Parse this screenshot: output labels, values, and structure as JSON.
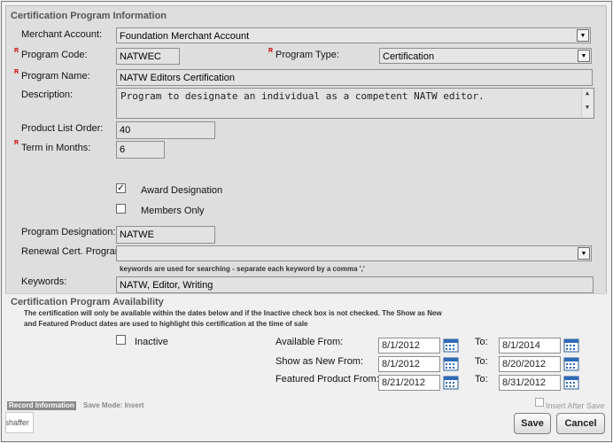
{
  "section_info": {
    "title": "Certification Program Information"
  },
  "merchant": {
    "label": "Merchant Account:",
    "value": "Foundation Merchant Account"
  },
  "program_code": {
    "label": "Program Code:",
    "value": "NATWEC"
  },
  "program_type": {
    "label": "Program Type:",
    "value": "Certification"
  },
  "program_name": {
    "label": "Program Name:",
    "value": "NATW Editors Certification"
  },
  "description": {
    "label": "Description:",
    "value": "Program to designate an individual as a competent NATW editor."
  },
  "product_list_order": {
    "label": "Product List Order:",
    "value": "40"
  },
  "term_months": {
    "label": "Term in Months:",
    "value": "6"
  },
  "required_marker": "R",
  "award_designation": {
    "label": "Award Designation",
    "checked": true,
    "check_glyph": "✓"
  },
  "members_only": {
    "label": "Members Only",
    "checked": false
  },
  "program_designation": {
    "label": "Program Designation:",
    "value": "NATWE"
  },
  "renewal": {
    "label": "Renewal Cert. Program",
    "value": ""
  },
  "keywords": {
    "label": "Keywords:",
    "hint": "keywords are used for searching - separate each keyword by a comma ','",
    "value": "NATW, Editor, Writing"
  },
  "availability": {
    "title": "Certification Program Availability",
    "note_line1": "The certification will only be available within the dates below and if the Inactive check box is not checked. The Show as New",
    "note_line2": "and Featured Product dates are used to highlight this certification at the time of sale",
    "inactive_label": "Inactive",
    "to_label": "To:",
    "rows": [
      {
        "label": "Available From:",
        "from": "8/1/2012",
        "to": "8/1/2014"
      },
      {
        "label": "Show as New From:",
        "from": "8/1/2012",
        "to": "8/20/2012"
      },
      {
        "label": "Featured Product From:",
        "from": "8/21/2012",
        "to": "8/31/2012"
      }
    ]
  },
  "footer": {
    "record_tab": "Record Information",
    "save_mode": "Save Mode: Insert",
    "user": "sshaffer",
    "insert_after_save": "Insert After Save",
    "save_button": "Save",
    "cancel_button": "Cancel"
  },
  "icons": {
    "dropdown": "dropdown-arrow-icon",
    "calendar": "calendar-icon"
  }
}
